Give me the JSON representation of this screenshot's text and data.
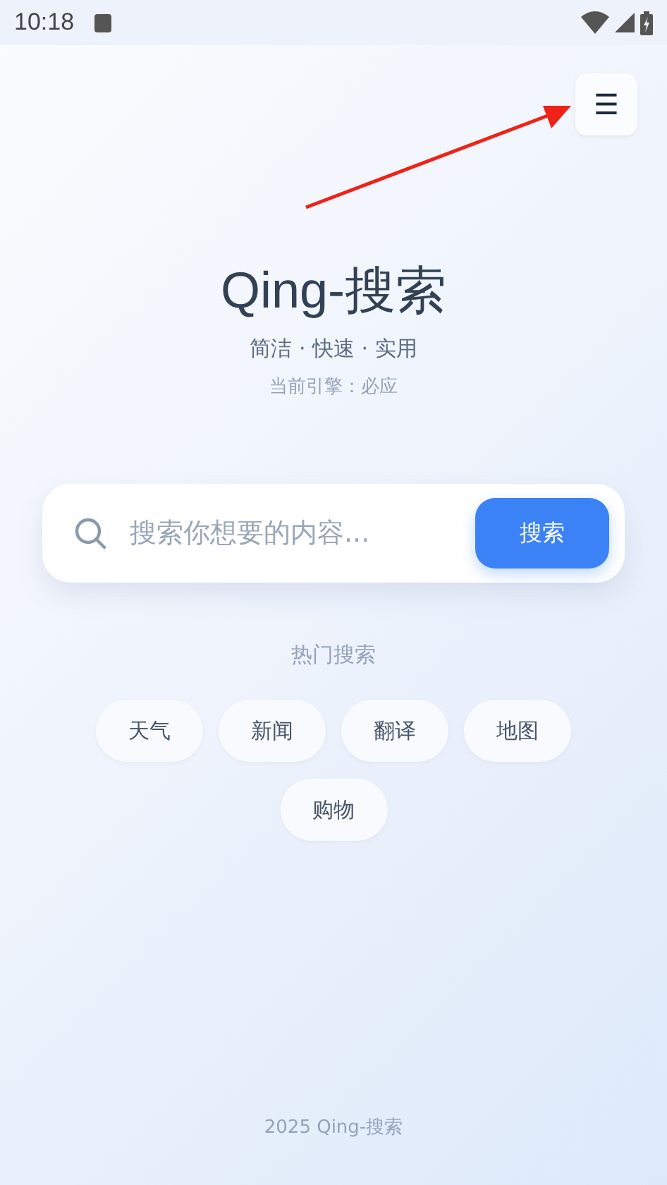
{
  "status_bar": {
    "time": "10:18"
  },
  "header": {
    "menu_button": "☰"
  },
  "title": "Qing-搜索",
  "tagline": "简洁 · 快速 · 实用",
  "engine": "当前引擎：必应",
  "search": {
    "placeholder": "搜索你想要的内容...",
    "button": "搜索"
  },
  "hot": {
    "label": "热门搜索",
    "tags": [
      "天气",
      "新闻",
      "翻译",
      "地图",
      "购物"
    ]
  },
  "footer": "2025 Qing-搜索"
}
